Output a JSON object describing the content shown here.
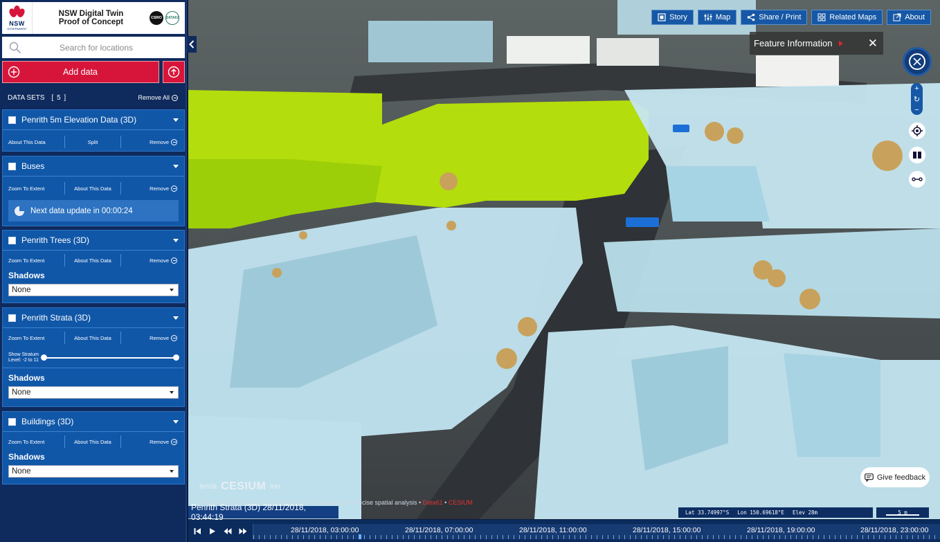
{
  "brand": {
    "logo_text": "NSW",
    "logo_subtext": "GOVERNMENT",
    "title_line1": "NSW Digital Twin",
    "title_line2": "Proof of Concept",
    "partner1": "CSIRO",
    "partner2": "DATA61"
  },
  "search": {
    "placeholder": "Search for locations"
  },
  "add_data": {
    "label": "Add data"
  },
  "datasets_header": {
    "label": "DATA SETS",
    "count": "[ 5 ]",
    "remove_all": "Remove All"
  },
  "datasets": [
    {
      "title": "Penrith 5m Elevation Data (3D)",
      "actions": [
        "About This Data",
        "Split",
        "Remove"
      ]
    },
    {
      "title": "Buses",
      "actions": [
        "Zoom To Extent",
        "About This Data",
        "Remove"
      ],
      "update_text": "Next data update in 00:00:24"
    },
    {
      "title": "Penrith Trees (3D)",
      "actions": [
        "Zoom To Extent",
        "About This Data",
        "Remove"
      ],
      "shadows_label": "Shadows",
      "shadows_value": "None"
    },
    {
      "title": "Penrith Strata (3D)",
      "actions": [
        "Zoom To Extent",
        "About This Data",
        "Remove"
      ],
      "stratum_label_1": "Show Stratum",
      "stratum_label_2": "Level: -2 to 11",
      "stratum_range": [
        -2,
        11
      ],
      "shadows_label": "Shadows",
      "shadows_value": "None"
    },
    {
      "title": "Buildings (3D)",
      "actions": [
        "Zoom To Extent",
        "About This Data",
        "Remove"
      ],
      "shadows_label": "Shadows",
      "shadows_value": "None"
    }
  ],
  "topnav": [
    "Story",
    "Map",
    "Share / Print",
    "Related Maps",
    "About"
  ],
  "feature_info": {
    "title": "Feature Information"
  },
  "map": {
    "feedback": "Give feedback",
    "logo_terria": "terria",
    "logo_cesium": "CESIUM",
    "logo_ion": "ion",
    "disclaimer": "Disclaimer: This map must not be used for navigation or precise spatial analysis",
    "disclaimer_link1": "Data61",
    "disclaimer_link2": "CESIUM",
    "layer_time": "Penrith Strata (3D) 28/11/2018, 03:44:19",
    "lat": "Lat  33.74997°S",
    "lon": "Lon  150.69618°E",
    "elev": "Elev  28m",
    "scale": "5 m"
  },
  "timeline": {
    "ticks": [
      "28/11/2018, 03:00:00",
      "28/11/2018, 07:00:00",
      "28/11/2018, 11:00:00",
      "28/11/2018, 15:00:00",
      "28/11/2018, 19:00:00",
      "28/11/2018, 23:00:00"
    ]
  },
  "colors": {
    "panel": "#0f2a5c",
    "dataset_card": "#1157a8",
    "accent_red": "#d7153a",
    "terrain_green": "#b3dd0c",
    "building_blue": "#bfe2ee"
  }
}
